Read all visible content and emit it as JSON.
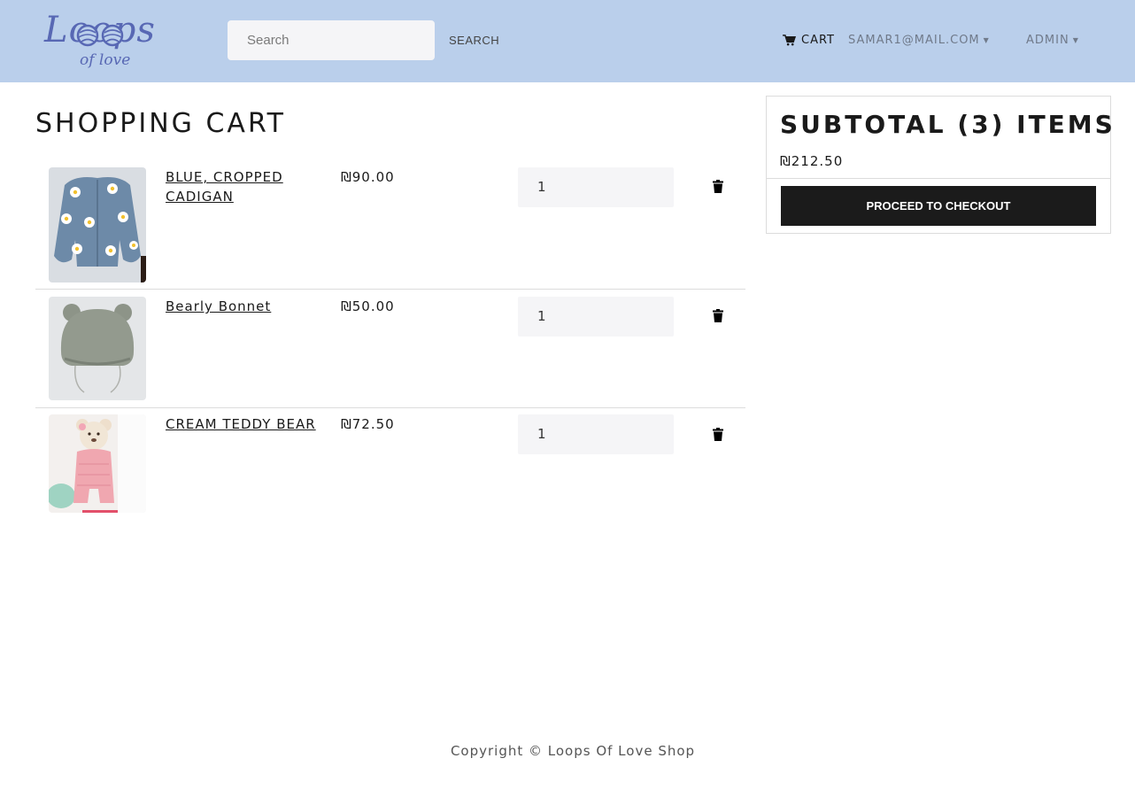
{
  "header": {
    "logo_main": "Loops",
    "logo_sub": "of love",
    "search_placeholder": "Search",
    "search_button": "SEARCH",
    "cart_label": "CART",
    "user_email": "SAMAR1@MAIL.COM",
    "admin_label": "ADMIN"
  },
  "cart": {
    "title": "SHOPPING CART",
    "items": [
      {
        "name": "BLUE, CROPPED CADIGAN",
        "price": "₪90.00",
        "quantity": "1"
      },
      {
        "name": "Bearly Bonnet",
        "price": "₪50.00",
        "quantity": "1"
      },
      {
        "name": "CREAM TEDDY BEAR",
        "price": "₪72.50",
        "quantity": "1"
      }
    ]
  },
  "summary": {
    "title": "SUBTOTAL (3) ITEMS",
    "total": "₪212.50",
    "checkout_button": "PROCEED TO CHECKOUT"
  },
  "footer": {
    "copyright": "Copyright © Loops Of Love Shop"
  },
  "icons": {
    "cart": "shopping-cart-icon",
    "delete": "trash-icon",
    "dropdown": "caret-down-icon"
  },
  "colors": {
    "header_bg": "#bacfeb",
    "logo": "#5868b4",
    "checkout_bg": "#1b1b1b",
    "nav_muted": "#707a8a"
  }
}
